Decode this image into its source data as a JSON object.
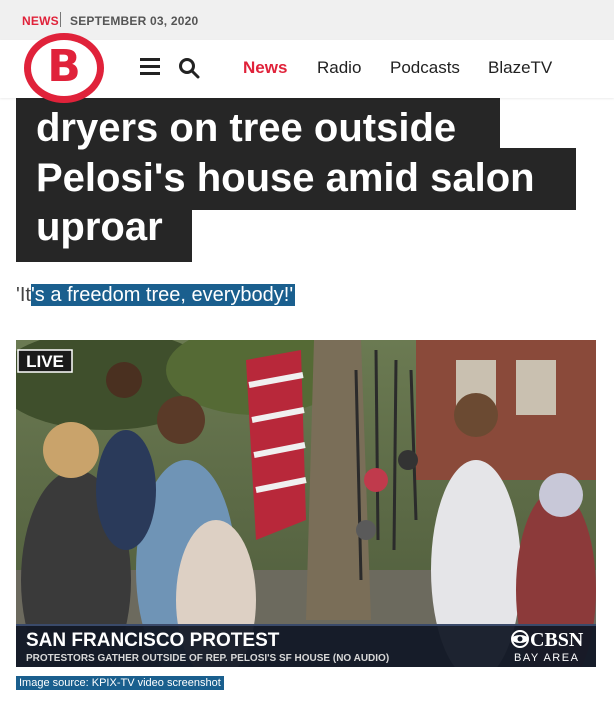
{
  "top_bar": {
    "category": "NEWS",
    "date": "SEPTEMBER 03, 2020"
  },
  "headline": {
    "lines": [
      "dryers on tree outside",
      "Pelosi's house amid salon",
      "uproar"
    ]
  },
  "nav": {
    "logo_letter": "B",
    "links": [
      "News",
      "Radio",
      "Podcasts",
      "BlazeTV"
    ],
    "active": "News"
  },
  "subhead": {
    "prefix": "'It",
    "highlighted": "'s a freedom tree, everybody!'"
  },
  "video": {
    "live_badge": "LIVE",
    "lower_third_title": "SAN FRANCISCO PROTEST",
    "lower_third_subtitle": "PROTESTORS GATHER OUTSIDE OF REP. PELOSI'S SF HOUSE (NO AUDIO)",
    "network": "CBSN",
    "network_sub": "BAY AREA"
  },
  "image_caption": "Image source: KPIX-TV video screenshot",
  "colors": {
    "brand_red": "#e0223a",
    "headline_bg": "#262626",
    "selection_blue": "#1a5f8e"
  }
}
